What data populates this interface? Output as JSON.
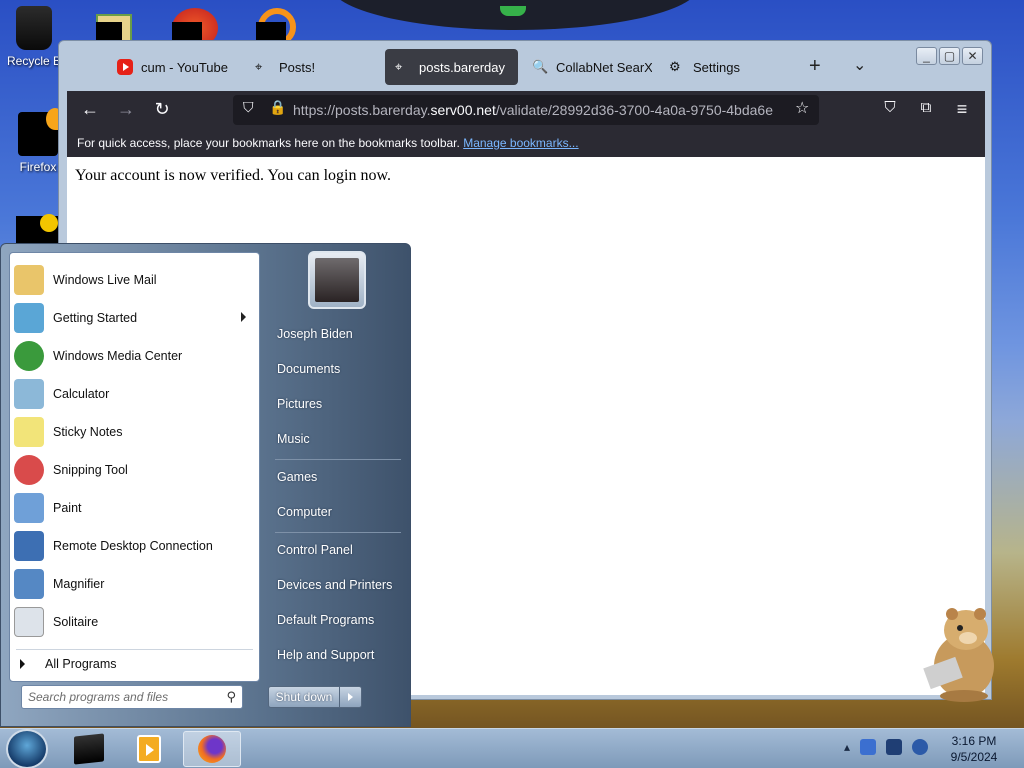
{
  "desktop": {
    "icons": [
      {
        "label": "Recycle B"
      },
      {
        "label": "Firefox"
      }
    ]
  },
  "browser": {
    "tabs": [
      {
        "label": "cum - YouTube",
        "icon": "youtube-icon"
      },
      {
        "label": "Posts!",
        "icon": "pin-icon"
      },
      {
        "label": "posts.barerday",
        "icon": "pin-icon",
        "active": true
      },
      {
        "label": "CollabNet SearXN",
        "icon": "search-icon"
      },
      {
        "label": "Settings",
        "icon": "gear-icon"
      }
    ],
    "new_tab": "+",
    "tab_list": "⌄",
    "url_prefix": "https://posts.barerday.",
    "url_host": "serv00.net",
    "url_path": "/validate/28992d36-3700-4a0a-9750-4bda6e",
    "bookmarks_text": "For quick access, place your bookmarks here on the bookmarks toolbar.",
    "bookmarks_link": "Manage bookmarks...",
    "page_text": "Your account is now verified. You can login now."
  },
  "start_menu": {
    "programs": [
      {
        "label": "Windows Live Mail",
        "color": "#e9c56a"
      },
      {
        "label": "Getting Started",
        "color": "#5aa6d6",
        "submenu": true
      },
      {
        "label": "Windows Media Center",
        "color": "#3a9a3c"
      },
      {
        "label": "Calculator",
        "color": "#8cb8d8"
      },
      {
        "label": "Sticky Notes",
        "color": "#f2e479"
      },
      {
        "label": "Snipping Tool",
        "color": "#d94b4b"
      },
      {
        "label": "Paint",
        "color": "#6fa0d8"
      },
      {
        "label": "Remote Desktop Connection",
        "color": "#3d6fb3"
      },
      {
        "label": "Magnifier",
        "color": "#5588c4"
      },
      {
        "label": "Solitaire",
        "color": "#dde3ea"
      }
    ],
    "all_programs": "All Programs",
    "search_placeholder": "Search programs and files",
    "right_items": [
      "Joseph Biden",
      "Documents",
      "Pictures",
      "Music",
      "Games",
      "Computer",
      "Control Panel",
      "Devices and Printers",
      "Default Programs",
      "Help and Support"
    ],
    "shutdown_label": "Shut down"
  },
  "taskbar": {
    "time": "3:16 PM",
    "date": "9/5/2024",
    "tray_arrow": "▴"
  }
}
